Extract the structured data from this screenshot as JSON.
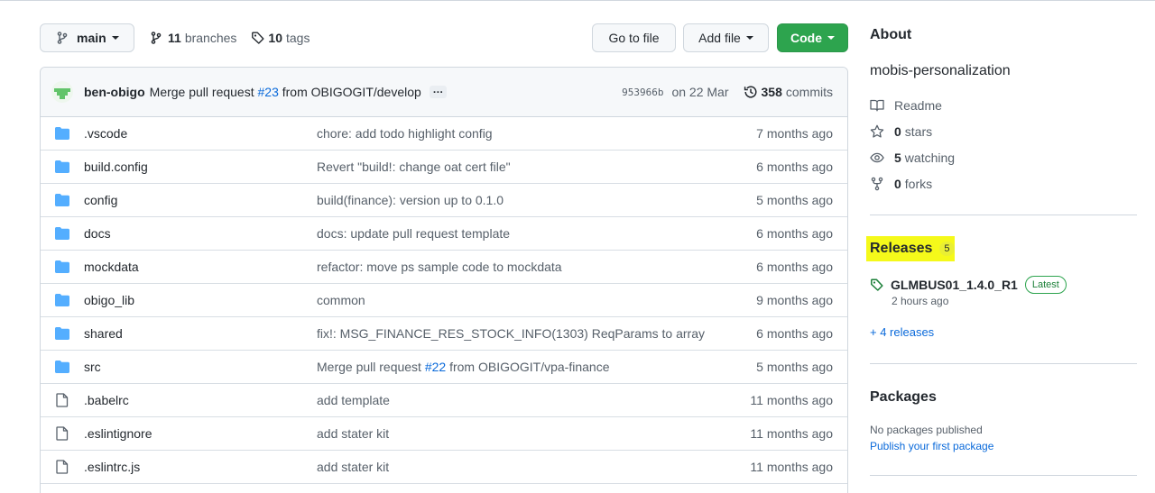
{
  "toolbar": {
    "branch_label": "main",
    "branches_count": "11",
    "branches_label": "branches",
    "tags_count": "10",
    "tags_label": "tags",
    "go_to_file_label": "Go to file",
    "add_file_label": "Add file",
    "code_label": "Code"
  },
  "commit": {
    "author": "ben-obigo",
    "message_prefix": "Merge pull request",
    "pr_number": "#23",
    "message_suffix": "from OBIGOGIT/develop",
    "ellipsis": "…",
    "sha": "953966b",
    "date": "on 22 Mar",
    "count": "358",
    "count_label": "commits"
  },
  "files": [
    {
      "name": ".vscode",
      "type": "folder",
      "commit": "chore: add todo highlight config",
      "age": "7 months ago"
    },
    {
      "name": "build.config",
      "type": "folder",
      "commit": "Revert \"build!: change oat cert file\"",
      "age": "6 months ago"
    },
    {
      "name": "config",
      "type": "folder",
      "commit": "build(finance): version up to 0.1.0",
      "age": "5 months ago"
    },
    {
      "name": "docs",
      "type": "folder",
      "commit": "docs: update pull request template",
      "age": "6 months ago"
    },
    {
      "name": "mockdata",
      "type": "folder",
      "commit": "refactor: move ps sample code to mockdata",
      "age": "6 months ago"
    },
    {
      "name": "obigo_lib",
      "type": "folder",
      "commit": "common",
      "age": "9 months ago"
    },
    {
      "name": "shared",
      "type": "folder",
      "commit": "fix!: MSG_FINANCE_RES_STOCK_INFO(1303) ReqParams to array",
      "age": "6 months ago"
    },
    {
      "name": "src",
      "type": "folder",
      "commit_prefix": "Merge pull request",
      "commit_pr": "#22",
      "commit_suffix": "from OBIGOGIT/vpa-finance",
      "age": "5 months ago"
    },
    {
      "name": ".babelrc",
      "type": "file",
      "commit": "add template",
      "age": "11 months ago"
    },
    {
      "name": ".eslintignore",
      "type": "file",
      "commit": "add stater kit",
      "age": "11 months ago"
    },
    {
      "name": ".eslintrc.js",
      "type": "file",
      "commit": "add stater kit",
      "age": "11 months ago"
    }
  ],
  "about": {
    "title": "About",
    "description": "mobis-personalization",
    "readme_label": "Readme",
    "stars_count": "0",
    "stars_label": "stars",
    "watching_count": "5",
    "watching_label": "watching",
    "forks_count": "0",
    "forks_label": "forks"
  },
  "releases": {
    "title": "Releases",
    "count": "5",
    "latest_name": "GLMBUS01_1.4.0_R1",
    "latest_badge": "Latest",
    "latest_time": "2 hours ago",
    "more_label": "+ 4 releases",
    "highlight_color": "#f5f91a"
  },
  "packages": {
    "title": "Packages",
    "empty_text": "No packages published",
    "publish_link": "Publish your first package"
  },
  "colors": {
    "accent_green": "#2da44e",
    "link_blue": "#0969da",
    "folder_blue": "#54aeff"
  }
}
